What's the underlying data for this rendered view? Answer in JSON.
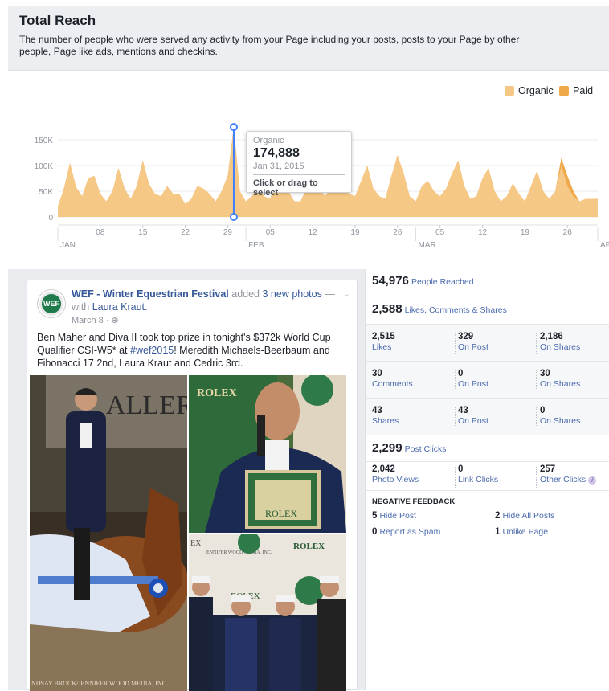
{
  "reach": {
    "title": "Total Reach",
    "description": "The number of people who were served any activity from your Page including your posts, posts to your Page by other people, Page like ads, mentions and checkins."
  },
  "chart_data": {
    "type": "area",
    "legend": [
      {
        "name": "Organic",
        "color": "#f6c886"
      },
      {
        "name": "Paid",
        "color": "#f0a94a"
      }
    ],
    "legend_position": "top-right",
    "y_ticks": [
      "0",
      "50K",
      "100K",
      "150K"
    ],
    "ylim": [
      0,
      175000
    ],
    "x_ticks": [
      "08",
      "15",
      "22",
      "29",
      "05",
      "12",
      "19",
      "26",
      "05",
      "12",
      "19",
      "26"
    ],
    "month_labels": [
      "JAN",
      "FEB",
      "MAR",
      "APR"
    ],
    "grid": true,
    "x_start": "2015-01-01",
    "x_end": "2015-04-01",
    "series": [
      {
        "name": "Organic",
        "values": [
          20000,
          55000,
          105000,
          58000,
          40000,
          75000,
          80000,
          45000,
          30000,
          50000,
          95000,
          55000,
          35000,
          60000,
          110000,
          65000,
          45000,
          40000,
          60000,
          45000,
          45000,
          25000,
          35000,
          60000,
          55000,
          45000,
          30000,
          50000,
          80000,
          174888,
          50000,
          30000,
          40000,
          60000,
          40000,
          35000,
          70000,
          80000,
          50000,
          30000,
          30000,
          55000,
          105000,
          60000,
          40000,
          55000,
          65000,
          75000,
          45000,
          40000,
          70000,
          100000,
          55000,
          40000,
          35000,
          80000,
          120000,
          85000,
          40000,
          30000,
          60000,
          70000,
          50000,
          40000,
          55000,
          85000,
          110000,
          60000,
          35000,
          40000,
          75000,
          95000,
          50000,
          30000,
          40000,
          65000,
          45000,
          30000,
          60000,
          90000,
          50000,
          35000,
          50000,
          100000,
          60000,
          40000,
          30000,
          35000,
          35000,
          35000
        ]
      },
      {
        "name": "Paid",
        "values": [
          0,
          0,
          0,
          0,
          0,
          0,
          0,
          0,
          0,
          0,
          0,
          0,
          0,
          0,
          0,
          0,
          0,
          0,
          0,
          0,
          0,
          0,
          0,
          0,
          0,
          0,
          0,
          0,
          0,
          0,
          0,
          0,
          0,
          0,
          0,
          0,
          0,
          0,
          0,
          0,
          0,
          0,
          0,
          0,
          0,
          0,
          0,
          0,
          0,
          0,
          0,
          0,
          0,
          0,
          0,
          0,
          0,
          0,
          0,
          0,
          0,
          0,
          0,
          0,
          0,
          0,
          0,
          0,
          0,
          0,
          0,
          0,
          0,
          0,
          0,
          0,
          0,
          0,
          0,
          0,
          0,
          0,
          0,
          15000,
          20000,
          10000,
          0,
          0,
          0,
          0
        ]
      }
    ],
    "tooltip": {
      "series": "Organic",
      "value": "174,888",
      "date": "Jan 31, 2015",
      "action": "Click or drag to select"
    }
  },
  "post": {
    "page_name": "WEF - Winter Equestrian Festival",
    "added": " added ",
    "photos": "3 new photos",
    "with": " — with ",
    "tagged": "Laura Kraut.",
    "date": "March 8 · ",
    "text_1": "Ben Maher and Diva II took top prize in tonight's $372k World Cup Qualifier CSI-W5* at ",
    "hashtag": "#wef2015",
    "text_2": "! Meredith Michaels-Beerbaum and Fibonacci 17 2nd, Laura Kraut and Cedric 3rd.",
    "photo_credit": "NDSAY BROCK/JENNIFER WOOD MEDIA, INC",
    "photo_sign_1": "ALLER",
    "photo_rolex_1": "ROLEX",
    "photo_rolex_2": "ROLEX",
    "photo_rolex_3": "ROLEX",
    "photo_rolex_4": "ROLEX",
    "photo_ex": "EX",
    "photo_credit_2": "ENNIFER WOOD MEDIA, INC.",
    "avatar_text": "WEF"
  },
  "stats": {
    "people_reached": {
      "num": "54,976",
      "label": "People Reached"
    },
    "engagement": {
      "num": "2,588",
      "label": "Likes, Comments & Shares"
    },
    "grid": [
      [
        {
          "num": "2,515",
          "label": "Likes"
        },
        {
          "num": "329",
          "label": "On Post"
        },
        {
          "num": "2,186",
          "label": "On Shares"
        }
      ],
      [
        {
          "num": "30",
          "label": "Comments"
        },
        {
          "num": "0",
          "label": "On Post"
        },
        {
          "num": "30",
          "label": "On Shares"
        }
      ],
      [
        {
          "num": "43",
          "label": "Shares"
        },
        {
          "num": "43",
          "label": "On Post"
        },
        {
          "num": "0",
          "label": "On Shares"
        }
      ]
    ],
    "post_clicks": {
      "num": "2,299",
      "label": "Post Clicks"
    },
    "clicks": [
      {
        "num": "2,042",
        "label": "Photo Views"
      },
      {
        "num": "0",
        "label": "Link Clicks"
      },
      {
        "num": "257",
        "label": "Other Clicks"
      }
    ],
    "negative": {
      "title": "NEGATIVE FEEDBACK",
      "items": [
        {
          "num": "5",
          "label": "Hide Post"
        },
        {
          "num": "2",
          "label": "Hide All Posts"
        },
        {
          "num": "0",
          "label": "Report as Spam"
        },
        {
          "num": "1",
          "label": "Unlike Page"
        }
      ]
    }
  }
}
